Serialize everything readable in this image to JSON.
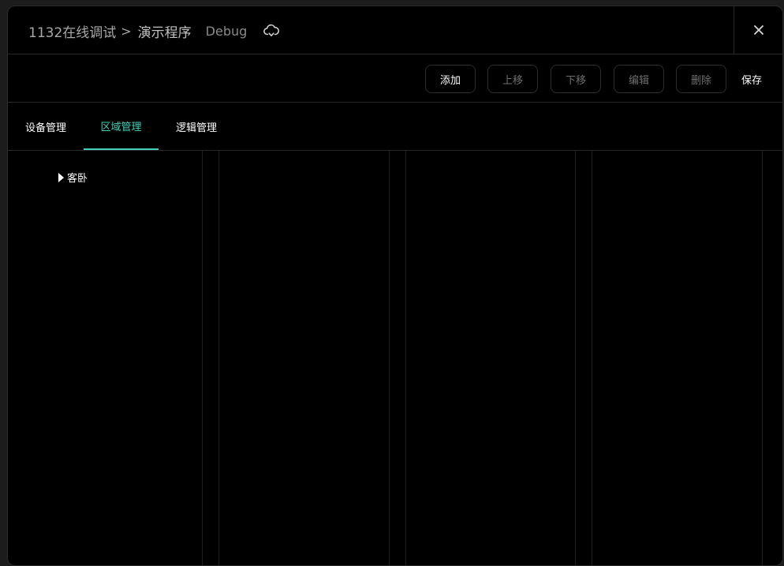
{
  "header": {
    "breadcrumb_root": "1132在线调试",
    "breadcrumb_sep": ">",
    "breadcrumb_current": "演示程序",
    "mode": "Debug",
    "cloud_icon": "cloud-sync-icon",
    "close_icon": "close-icon"
  },
  "toolbar": {
    "add_label": "添加",
    "move_up_label": "上移",
    "move_down_label": "下移",
    "edit_label": "编辑",
    "delete_label": "删除",
    "save_label": "保存"
  },
  "tabs": [
    {
      "label": "设备管理",
      "active": false
    },
    {
      "label": "区域管理",
      "active": true
    },
    {
      "label": "逻辑管理",
      "active": false
    }
  ],
  "tree": {
    "items": [
      {
        "label": "客卧",
        "expanded": false
      }
    ]
  },
  "colors": {
    "accent": "#3fd1b9",
    "background": "#000000",
    "border": "#262626"
  }
}
